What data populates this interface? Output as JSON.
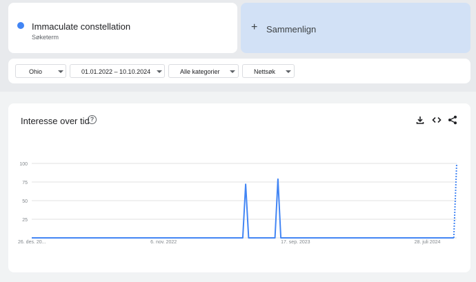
{
  "term": {
    "title": "Immaculate constellation",
    "subtitle": "Søketerm",
    "color": "#4285f4"
  },
  "compare": {
    "plus": "+",
    "label": "Sammenlign"
  },
  "filters": {
    "region": "Ohio",
    "daterange": "01.01.2022 – 10.10.2024",
    "category": "Alle kategorier",
    "search_type": "Nettsøk"
  },
  "chart_panel": {
    "title": "Interesse over tid",
    "help_icon": "question-circle-icon",
    "tools": [
      "download-icon",
      "embed-code-icon",
      "share-icon"
    ]
  },
  "chart_data": {
    "type": "line",
    "title": "Interesse over tid",
    "xlabel": "",
    "ylabel": "",
    "ylim": [
      0,
      100
    ],
    "yticks": [
      25,
      50,
      75,
      100
    ],
    "xticks": [
      {
        "label": "26. des. 20...",
        "x": "2021-12-26"
      },
      {
        "label": "6. nov. 2022",
        "x": "2022-11-06"
      },
      {
        "label": "17. sep. 2023",
        "x": "2023-09-17"
      },
      {
        "label": "28. juli 2024",
        "x": "2024-07-28"
      }
    ],
    "xrange": [
      "2021-12-26",
      "2024-10-06"
    ],
    "series": [
      {
        "color": "#4285f4",
        "points": [
          {
            "x": "2021-12-26",
            "y": 0
          },
          {
            "x": "2023-05-14",
            "y": 0
          },
          {
            "x": "2023-05-21",
            "y": 72
          },
          {
            "x": "2023-05-28",
            "y": 0
          },
          {
            "x": "2023-07-30",
            "y": 0
          },
          {
            "x": "2023-08-06",
            "y": 79
          },
          {
            "x": "2023-08-13",
            "y": 0
          },
          {
            "x": "2024-09-29",
            "y": 0
          }
        ],
        "partial": [
          {
            "x": "2024-09-29",
            "y": 0
          },
          {
            "x": "2024-10-06",
            "y": 100
          }
        ]
      }
    ],
    "grid": true
  }
}
